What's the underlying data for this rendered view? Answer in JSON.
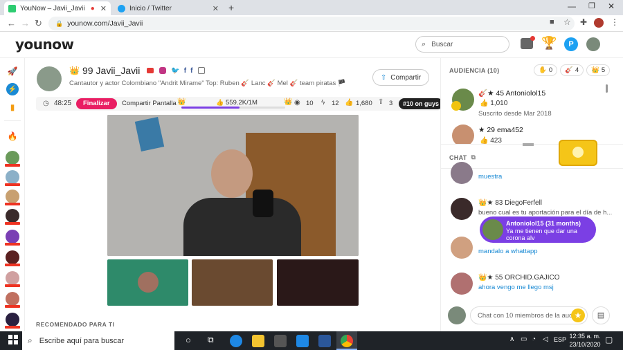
{
  "browser": {
    "tabs": [
      {
        "title": "YouNow – Javii_Javii",
        "active": true
      },
      {
        "title": "Inicio / Twitter",
        "active": false
      }
    ],
    "url": "younow.com/Javii_Javii"
  },
  "header": {
    "logo": "younow",
    "search_placeholder": "Buscar"
  },
  "streamer": {
    "level": "99",
    "name": "Javii_Javii",
    "bio": "Cantautor y actor Colombiano \"Andrit Mirame\" Top: Ruben 🎸 Lanc 🎸 Mel 🎸 team piratas 🏴",
    "share_label": "Compartir"
  },
  "stats_bar": {
    "time": "48:25",
    "end_button": "Finalizar",
    "share_screen": "Compartir Pantalla",
    "likes": "559.2K/1M",
    "likes_progress": 0.56,
    "viewers": "10",
    "bolt": "12",
    "fans": "1,680",
    "shares": "3",
    "rank_badge": "#10 on guys"
  },
  "recommended_label": "RECOMENDADO PARA TI",
  "audience": {
    "title": "AUDIENCIA (10)",
    "counts": [
      "0",
      "4",
      "5"
    ],
    "members": [
      {
        "level": "45",
        "name": "Antoniolol15",
        "value": "1,010",
        "since": "Suscrito desde Mar 2018"
      },
      {
        "level": "29",
        "name": "ema452",
        "value": "423"
      }
    ]
  },
  "chat": {
    "title": "CHAT",
    "messages": [
      {
        "name": "",
        "text": "muestra"
      },
      {
        "name": "83 DiegoFerfell",
        "text": "bueno cual es tu aportación para el día de h..."
      },
      {
        "name": "",
        "text": "mandalo a whattapp"
      },
      {
        "name": "55 ORCHID.GAJICO",
        "text": "ahora vengo me llego msj"
      }
    ],
    "popup": {
      "name": "Antoniolol15 (31 months)",
      "text": "Ya me tienen que dar una corona alv"
    },
    "input_placeholder": "Chat con 10 miembros de la audie"
  },
  "taskbar": {
    "search": "Escribe aquí para buscar",
    "lang": "ESP",
    "time": "12:35 a. m.",
    "date": "23/10/2020"
  },
  "colors": {
    "accent": "#e91e63",
    "purple": "#7b3fe4",
    "link": "#1a8ad4"
  }
}
